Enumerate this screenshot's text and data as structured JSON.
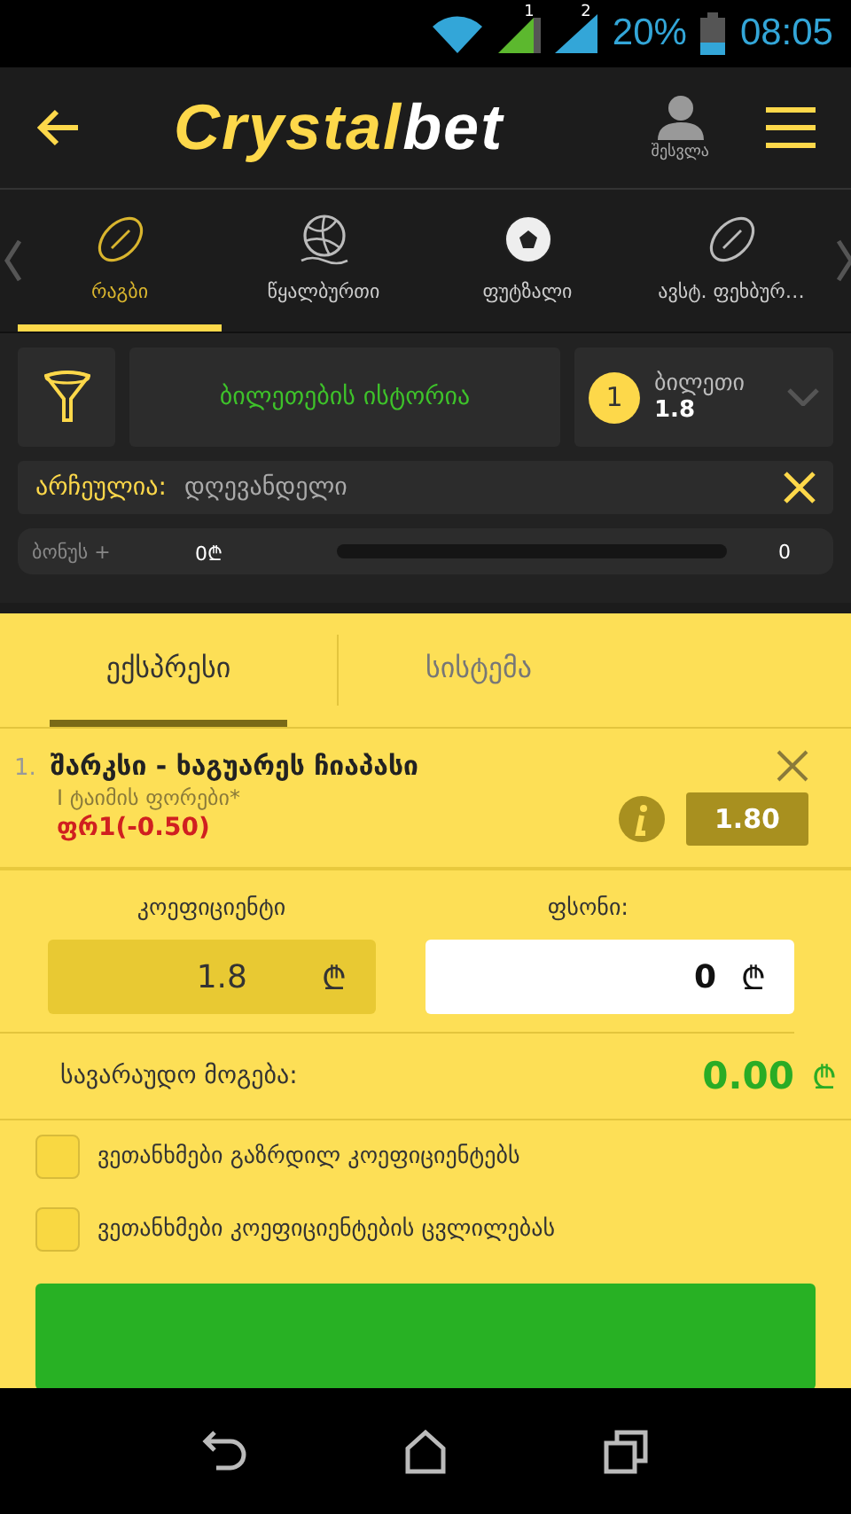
{
  "status_bar": {
    "sim_1": "1",
    "sim_2": "2",
    "battery": "20%",
    "time": "08:05"
  },
  "header": {
    "logo_main": "Crystal",
    "logo_accent": "bet",
    "login_label": "შესვლა"
  },
  "sport_tabs": [
    {
      "label": "რაგბი",
      "kind": "rugby",
      "selected": true
    },
    {
      "label": "წყალბურთი",
      "kind": "waterpolo",
      "selected": false
    },
    {
      "label": "ფუტზალი",
      "kind": "futsal",
      "selected": false
    },
    {
      "label": "ავსტ. ფეხბურ…",
      "kind": "aussie",
      "selected": false
    }
  ],
  "history_button": "ბილეთების ისტორია",
  "ticket": {
    "count": "1",
    "label": "ბილეთი",
    "odds": "1.8"
  },
  "filter": {
    "label": "არჩეულია:",
    "value": "დღევანდელი"
  },
  "bonus": {
    "label": "ბონუს +",
    "amount": "0₾",
    "level": 0,
    "value": "0"
  },
  "bet_tabs": [
    {
      "label": "ექსპრესი",
      "selected": true
    },
    {
      "label": "სისტემა",
      "selected": false
    }
  ],
  "selections": [
    {
      "index": "1.",
      "event": "შარკსი - ხაგუარეს ჩიაპასი",
      "market": "I ტაიმის ფორები*",
      "pick": "ფრ1(-0.50)",
      "odds": "1.80"
    }
  ],
  "odds_field": {
    "label": "კოეფიციენტი",
    "value": "1.8",
    "currency": "₾"
  },
  "stake_field": {
    "label": "ფსონი:",
    "value": "0",
    "currency": "₾"
  },
  "potential_win": {
    "label": "სავარაუდო მოგება:",
    "value": "0.00",
    "currency": "₾"
  },
  "agreements": [
    {
      "label": "ვეთანხმები გაზრდილ კოეფიციენტებს",
      "checked": false
    },
    {
      "label": "ვეთანხმები კოეფიციენტების ცვლილებას",
      "checked": false
    }
  ]
}
